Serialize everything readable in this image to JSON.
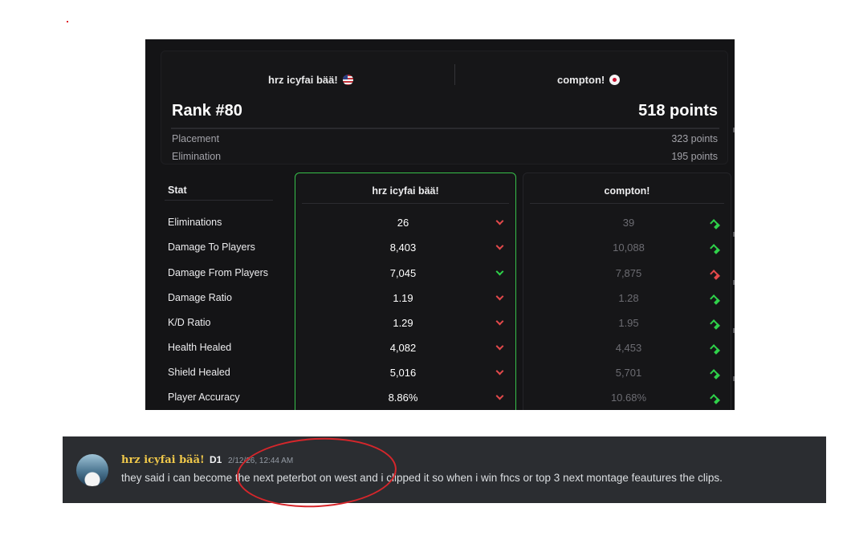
{
  "players": {
    "left": {
      "name": "hrz icyfai bää!",
      "flag": "us-flag"
    },
    "right": {
      "name": "compton!",
      "flag": "jp-flag"
    }
  },
  "summary": {
    "rank": "Rank #80",
    "points": "518 points",
    "breakdown": [
      {
        "label": "Placement",
        "value": "323 points"
      },
      {
        "label": "Elimination",
        "value": "195 points"
      }
    ]
  },
  "table": {
    "stat_header": "Stat",
    "col1_header": "hrz icyfai bää!",
    "col2_header": "compton!",
    "rows": [
      {
        "stat": "Eliminations",
        "v1": "26",
        "a1": "down",
        "c1": "red",
        "v2": "39",
        "a2": "up",
        "c2": "green"
      },
      {
        "stat": "Damage To Players",
        "v1": "8,403",
        "a1": "down",
        "c1": "red",
        "v2": "10,088",
        "a2": "up",
        "c2": "green"
      },
      {
        "stat": "Damage From Players",
        "v1": "7,045",
        "a1": "down",
        "c1": "green",
        "v2": "7,875",
        "a2": "up",
        "c2": "red"
      },
      {
        "stat": "Damage Ratio",
        "v1": "1.19",
        "a1": "down",
        "c1": "red",
        "v2": "1.28",
        "a2": "up",
        "c2": "green"
      },
      {
        "stat": "K/D Ratio",
        "v1": "1.29",
        "a1": "down",
        "c1": "red",
        "v2": "1.95",
        "a2": "up",
        "c2": "green"
      },
      {
        "stat": "Health Healed",
        "v1": "4,082",
        "a1": "down",
        "c1": "red",
        "v2": "4,453",
        "a2": "up",
        "c2": "green"
      },
      {
        "stat": "Shield Healed",
        "v1": "5,016",
        "a1": "down",
        "c1": "red",
        "v2": "5,701",
        "a2": "up",
        "c2": "green"
      },
      {
        "stat": "Player Accuracy",
        "v1": "8.86%",
        "a1": "down",
        "c1": "red",
        "v2": "10.68%",
        "a2": "up",
        "c2": "green"
      }
    ]
  },
  "message": {
    "author": "hrz icyfai bää!",
    "tag": "D1",
    "timestamp": "2/12/26, 12:44 AM",
    "text": "they said i can become the next peterbot on west and i clipped it so when i win fncs or top 3 next montage feautures the clips."
  },
  "colors": {
    "accent_green": "#37c04a",
    "down_red": "#e3494b",
    "up_green": "#2fd14a",
    "author_gold": "#f0c84a",
    "annotation_red": "#d6262b"
  }
}
